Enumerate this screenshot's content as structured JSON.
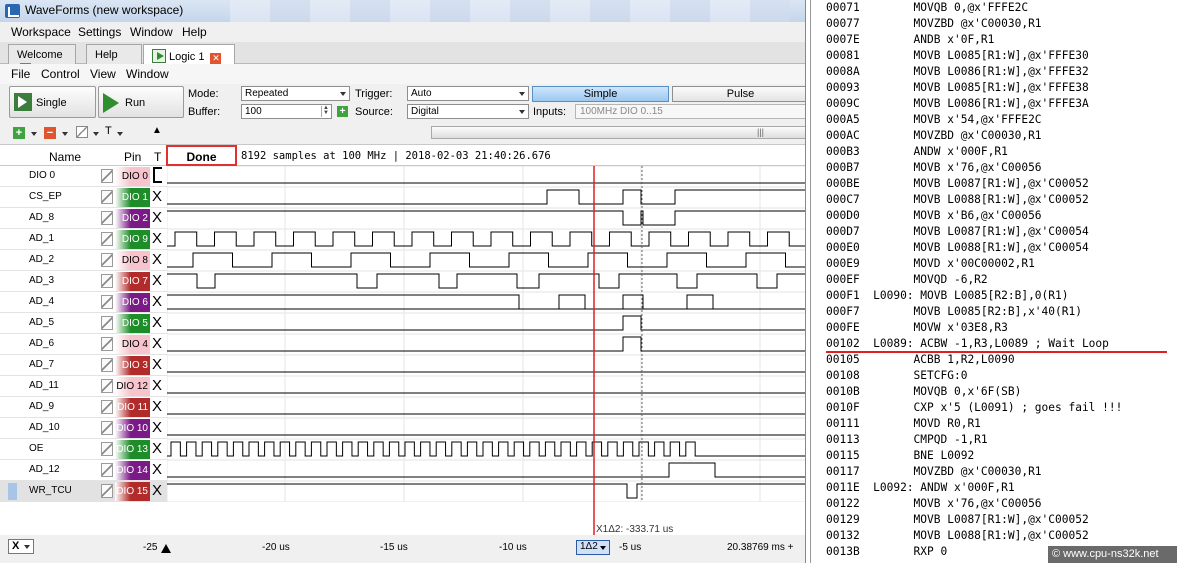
{
  "window": {
    "title": "WaveForms  (new workspace)"
  },
  "menu": [
    "Workspace",
    "Settings",
    "Window",
    "Help"
  ],
  "tabs": [
    {
      "label": "Welcome"
    },
    {
      "label": "Help"
    },
    {
      "label": "Logic 1"
    }
  ],
  "submenu": [
    "File",
    "Control",
    "View",
    "Window"
  ],
  "controls": {
    "single_label": "Single",
    "run_label": "Run",
    "mode_label": "Mode:",
    "mode_value": "Repeated",
    "buffer_label": "Buffer:",
    "buffer_value": "100",
    "trigger_label": "Trigger:",
    "trigger_value": "Auto",
    "source_label": "Source:",
    "source_value": "Digital",
    "simple_label": "Simple",
    "pulse_label": "Pulse",
    "inputs_label": "Inputs:",
    "inputs_value": "100MHz DIO 0..15"
  },
  "toolbar": {
    "t_label": "T"
  },
  "header": {
    "name": "Name",
    "pin": "Pin",
    "t": "T",
    "done": "Done",
    "status": "8192 samples at 100 MHz | 2018-02-03 21:40:26.676"
  },
  "signals": [
    {
      "name": "DIO 0",
      "pin": "DIO 0",
      "color": "#f7c3cc",
      "text": "#000000",
      "trig": "fall"
    },
    {
      "name": "CS_EP",
      "pin": "DIO 1",
      "color": "#1f8c2a",
      "text": "#ffffff",
      "trig": "X"
    },
    {
      "name": "AD_8",
      "pin": "DIO 2",
      "color": "#7a1a86",
      "text": "#ffffff",
      "trig": "X"
    },
    {
      "name": "AD_1",
      "pin": "DIO 9",
      "color": "#1f8c2a",
      "text": "#ffffff",
      "trig": "X"
    },
    {
      "name": "AD_2",
      "pin": "DIO 8",
      "color": "#f7c3cc",
      "text": "#000000",
      "trig": "X"
    },
    {
      "name": "AD_3",
      "pin": "DIO 7",
      "color": "#b22b2b",
      "text": "#ffffff",
      "trig": "X"
    },
    {
      "name": "AD_4",
      "pin": "DIO 6",
      "color": "#7a1a86",
      "text": "#ffffff",
      "trig": "X"
    },
    {
      "name": "AD_5",
      "pin": "DIO 5",
      "color": "#1f8c2a",
      "text": "#ffffff",
      "trig": "X"
    },
    {
      "name": "AD_6",
      "pin": "DIO 4",
      "color": "#f7c3cc",
      "text": "#000000",
      "trig": "X"
    },
    {
      "name": "AD_7",
      "pin": "DIO 3",
      "color": "#b22b2b",
      "text": "#ffffff",
      "trig": "X"
    },
    {
      "name": "AD_11",
      "pin": "DIO 12",
      "color": "#f7c3cc",
      "text": "#000000",
      "trig": "X"
    },
    {
      "name": "AD_9",
      "pin": "DIO 11",
      "color": "#b22b2b",
      "text": "#ffffff",
      "trig": "X"
    },
    {
      "name": "AD_10",
      "pin": "DIO 10",
      "color": "#7a1a86",
      "text": "#ffffff",
      "trig": "X"
    },
    {
      "name": "OE",
      "pin": "DIO 13",
      "color": "#1f8c2a",
      "text": "#ffffff",
      "trig": "X"
    },
    {
      "name": "AD_12",
      "pin": "DIO 14",
      "color": "#7a1a86",
      "text": "#ffffff",
      "trig": "X"
    },
    {
      "name": "WR_TCU",
      "pin": "DIO 15",
      "color": "#b22b2b",
      "text": "#ffffff",
      "trig": "X",
      "selected": true
    }
  ],
  "cursor": {
    "label": "X1Δ2: -333.71 us",
    "delta_button": "1Δ2"
  },
  "axis": {
    "x_button": "X",
    "ticks": [
      "-25",
      "-20 us",
      "-15 us",
      "-10 us",
      "-5 us",
      "20.38769 ms +"
    ]
  },
  "listing": [
    "00071        MOVQB 0,@x'FFFE2C",
    "00077        MOVZBD @x'C00030,R1",
    "0007E        ANDB x'0F,R1",
    "00081        MOVB L0085[R1:W],@x'FFFE30",
    "0008A        MOVB L0086[R1:W],@x'FFFE32",
    "00093        MOVB L0085[R1:W],@x'FFFE38",
    "0009C        MOVB L0086[R1:W],@x'FFFE3A",
    "000A5        MOVB x'54,@x'FFFE2C",
    "000AC        MOVZBD @x'C00030,R1",
    "000B3        ANDW x'000F,R1",
    "000B7        MOVB x'76,@x'C00056",
    "000BE        MOVB L0087[R1:W],@x'C00052",
    "000C7        MOVB L0088[R1:W],@x'C00052",
    "000D0        MOVB x'B6,@x'C00056",
    "000D7        MOVB L0087[R1:W],@x'C00054",
    "000E0        MOVB L0088[R1:W],@x'C00054",
    "000E9        MOVD x'00C00002,R1",
    "000EF        MOVQD -6,R2",
    "000F1  L0090: MOVB L0085[R2:B],0(R1)",
    "000F7        MOVB L0085[R2:B],x'40(R1)",
    "000FE        MOVW x'03E8,R3",
    "00102  L0089: ACBW -1,R3,L0089 ; Wait Loop",
    "00105        ACBB 1,R2,L0090",
    "00108        SETCFG:0",
    "0010B        MOVQB 0,x'6F(SB)",
    "0010F        CXP x'5 (L0091) ; goes fail !!!",
    "00111        MOVD R0,R1",
    "00113        CMPQD -1,R1",
    "00115        BNE L0092",
    "00117        MOVZBD @x'C00030,R1",
    "0011E  L0092: ANDW x'000F,R1",
    "00122        MOVB x'76,@x'C00056",
    "00129        MOVB L0087[R1:W],@x'C00052",
    "00132        MOVB L0088[R1:W],@x'C00052",
    "0013B        RXP 0"
  ],
  "watermark": "© www.cpu-ns32k.net"
}
